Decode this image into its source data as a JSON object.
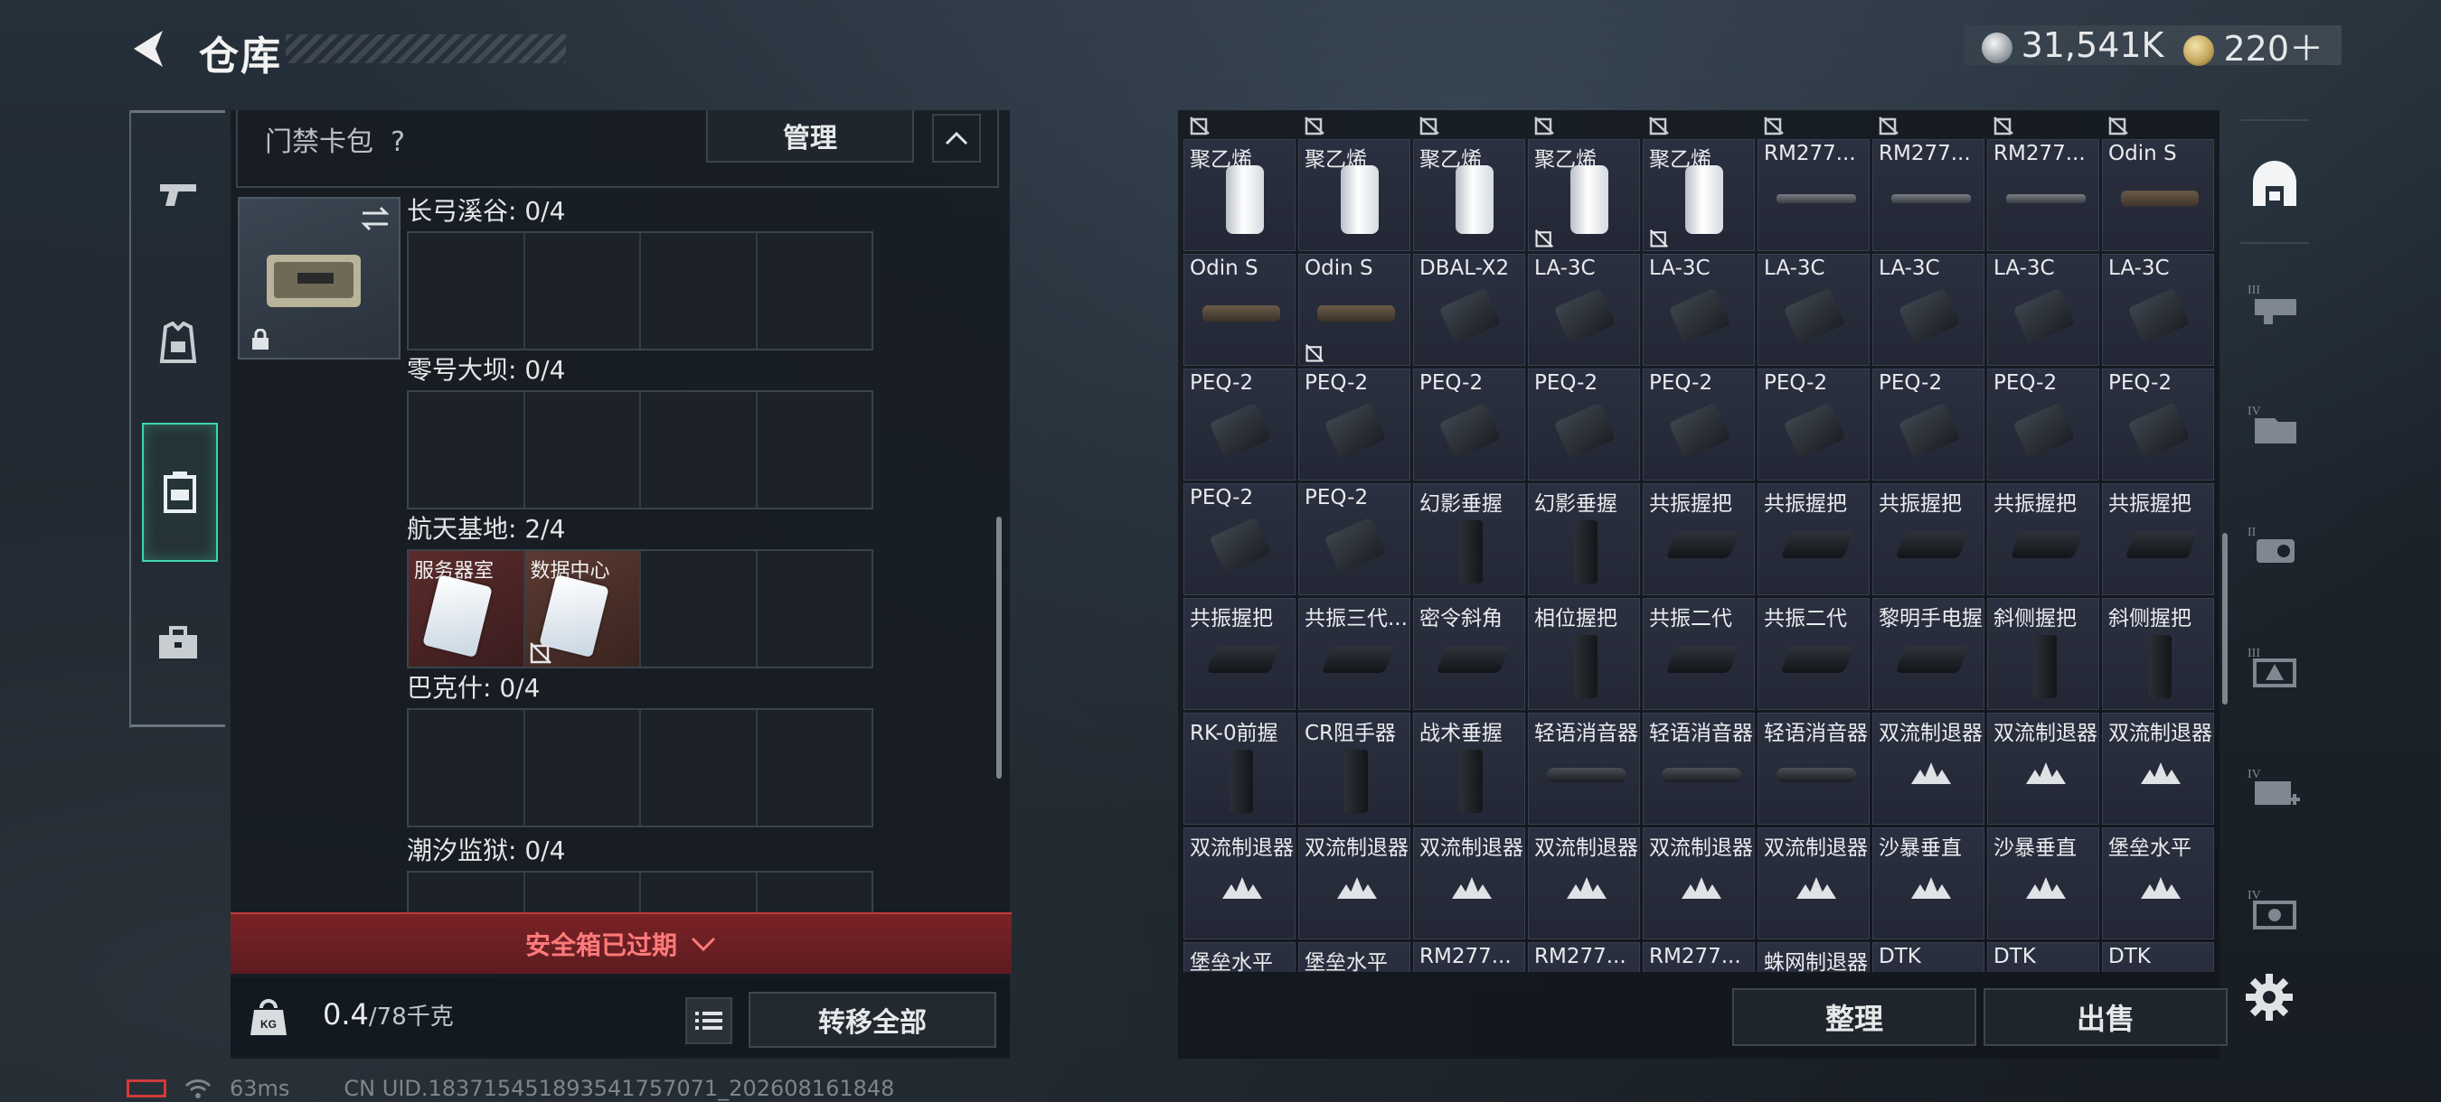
{
  "header": {
    "title": "仓库",
    "silver_amount": "31,541K",
    "gold_amount": "220＋"
  },
  "left_nav": {
    "items": [
      {
        "id": "weapons",
        "icon": "pistol-icon"
      },
      {
        "id": "gear",
        "icon": "vest-icon"
      },
      {
        "id": "case",
        "icon": "case-icon",
        "active": true
      },
      {
        "id": "toolbox",
        "icon": "toolbox-icon"
      }
    ]
  },
  "keybag": {
    "label": "门禁卡包",
    "help": "?",
    "manage_label": "管理",
    "zones": [
      {
        "name": "长弓溪谷: 0/4",
        "slots": [
          "",
          "",
          "",
          ""
        ]
      },
      {
        "name": "零号大坝: 0/4",
        "slots": [
          "",
          "",
          "",
          ""
        ]
      },
      {
        "name": "航天基地: 2/4",
        "slots": [
          "服务器室",
          "数据中心",
          "",
          ""
        ]
      },
      {
        "name": "巴克什: 0/4",
        "slots": [
          "",
          "",
          "",
          ""
        ]
      },
      {
        "name": "潮汐监狱: 0/4",
        "slots": [
          "",
          "",
          "",
          ""
        ]
      }
    ],
    "expired_label": "安全箱已过期",
    "weight_value": "0.4",
    "weight_cap": "/78千克",
    "transfer_label": "转移全部"
  },
  "grid": {
    "rows": [
      [
        "聚乙烯",
        "聚乙烯",
        "聚乙烯",
        "聚乙烯",
        "聚乙烯",
        "RM277...",
        "RM277...",
        "RM277...",
        "Odin S"
      ],
      [
        "Odin S",
        "Odin S",
        "DBAL-X2",
        "LA-3C",
        "LA-3C",
        "LA-3C",
        "LA-3C",
        "LA-3C",
        "LA-3C"
      ],
      [
        "PEQ-2",
        "PEQ-2",
        "PEQ-2",
        "PEQ-2",
        "PEQ-2",
        "PEQ-2",
        "PEQ-2",
        "PEQ-2",
        "PEQ-2"
      ],
      [
        "PEQ-2",
        "PEQ-2",
        "幻影垂握",
        "幻影垂握",
        "共振握把",
        "共振握把",
        "共振握把",
        "共振握把",
        "共振握把"
      ],
      [
        "共振握把",
        "共振三代...",
        "密令斜角",
        "相位握把",
        "共振二代",
        "共振二代",
        "黎明手电握",
        "斜侧握把",
        "斜侧握把"
      ],
      [
        "RK-0前握",
        "CR阻手器",
        "战术垂握",
        "轻语消音器",
        "轻语消音器",
        "轻语消音器",
        "双流制退器",
        "双流制退器",
        "双流制退器"
      ],
      [
        "双流制退器",
        "双流制退器",
        "双流制退器",
        "双流制退器",
        "双流制退器",
        "双流制退器",
        "沙暴垂直",
        "沙暴垂直",
        "堡垒水平"
      ],
      [
        "堡垒水平",
        "堡垒水平",
        "RM277...",
        "RM277...",
        "RM277...",
        "蛛网制退器",
        "DTK",
        "DTK",
        "DTK"
      ]
    ],
    "sort_label": "整理",
    "sell_label": "出售"
  },
  "right_nav": {
    "items": [
      "vault-icon",
      "category-3-icon",
      "category-4-icon",
      "category-2-icon",
      "category-3b-icon",
      "category-4b-icon",
      "category-4c-icon"
    ]
  },
  "footer": {
    "ping": "63ms",
    "uid": "CN UID.183715451893541757071_202608161848"
  },
  "colors": {
    "accent": "#3fd4ae",
    "expired": "#ff7a7a",
    "keycard_slot": "#5c2b2b"
  }
}
